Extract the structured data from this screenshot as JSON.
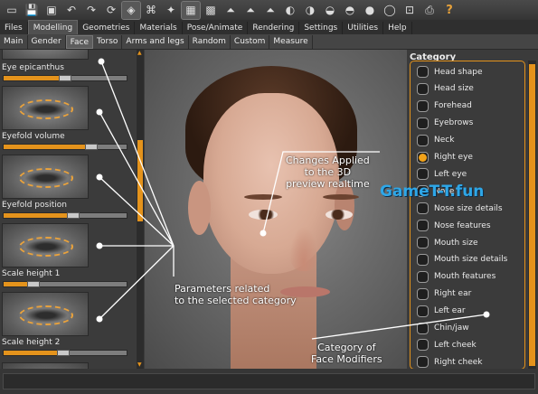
{
  "toolbar": {
    "icons": [
      "window-icon",
      "save-icon",
      "load-icon",
      "undo-icon",
      "redo-icon",
      "reset-icon",
      "smooth-icon",
      "wireframe-icon",
      "pose-icon",
      "grid-icon",
      "checker-icon",
      "front-view-icon",
      "side-view-icon",
      "back-view-icon",
      "face-front-icon",
      "face-side-icon",
      "face-top-icon",
      "face-left-icon",
      "face-right-icon",
      "sphere-icon",
      "reset-camera-icon",
      "screenshot-icon",
      "help-icon"
    ],
    "help_label": "?"
  },
  "menu": {
    "tabs": [
      "Files",
      "Modelling",
      "Geometries",
      "Materials",
      "Pose/Animate",
      "Rendering",
      "Settings",
      "Utilities",
      "Help"
    ],
    "active": "Modelling"
  },
  "subtabs": {
    "tabs": [
      "Main",
      "Gender",
      "Face",
      "Torso",
      "Arms and legs",
      "Random",
      "Custom",
      "Measure"
    ],
    "active": "Face"
  },
  "sliders": [
    {
      "label": "Eye epicanthus",
      "value": 0.46
    },
    {
      "label": "Eyefold volume",
      "value": 0.67
    },
    {
      "label": "Eyefold position",
      "value": 0.52
    },
    {
      "label": "Scale height 1",
      "value": 0.2
    },
    {
      "label": "Scale height 2",
      "value": 0.44
    }
  ],
  "category": {
    "title": "Category",
    "items": [
      "Head shape",
      "Head size",
      "Forehead",
      "Eyebrows",
      "Neck",
      "Right eye",
      "Left eye",
      "Nose",
      "Nose size details",
      "Nose features",
      "Mouth size",
      "Mouth size details",
      "Mouth features",
      "Right ear",
      "Left ear",
      "Chin/jaw",
      "Left cheek",
      "Right cheek"
    ],
    "selected": "Right eye"
  },
  "annotations": {
    "changes_line1": "Changes Applied",
    "changes_line2": "to the 3D",
    "changes_line3": "preview realtime",
    "params_line1": "Parameters related",
    "params_line2": "to  the selected category",
    "cat_line1": "Category of",
    "cat_line2": "Face Modifiers"
  },
  "watermark": "GameT-T.fun",
  "colors": {
    "accent": "#e4931c",
    "watermark": "#2ea7e8"
  }
}
